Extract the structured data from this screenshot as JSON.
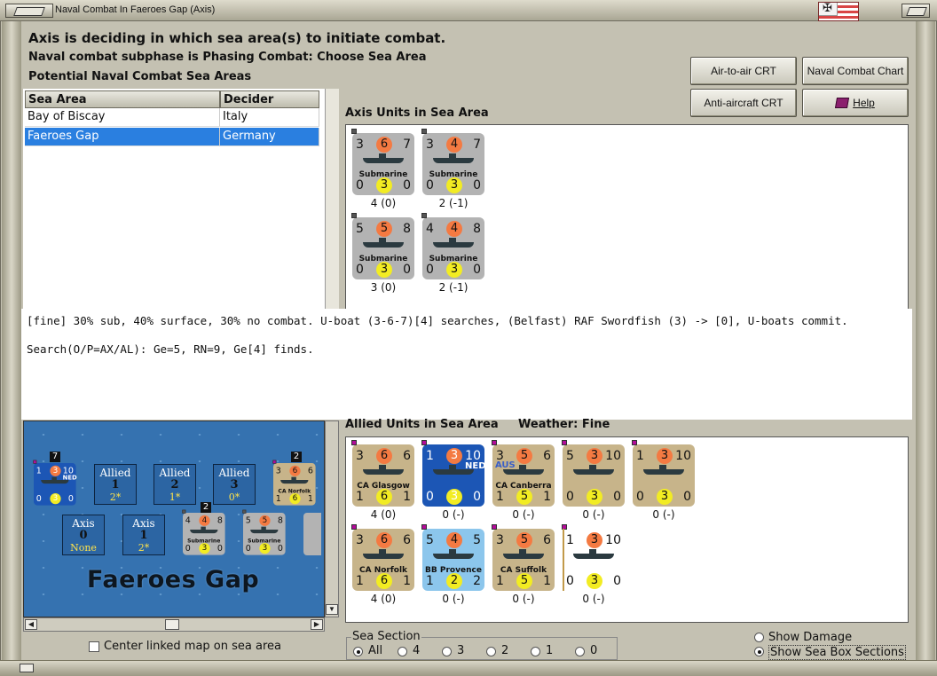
{
  "window": {
    "title": "Naval Combat In Faeroes Gap (Axis)"
  },
  "header": {
    "line1": "Axis is deciding in which sea area(s) to initiate combat.",
    "line2": "Naval combat subphase is Phasing Combat: Choose Sea Area",
    "line3": "Potential Naval Combat Sea Areas"
  },
  "buttons": {
    "air_to_air": "Air-to-air CRT",
    "naval_chart": "Naval Combat Chart",
    "anti_aircraft": "Anti-aircraft CRT",
    "help": "Help"
  },
  "sea_table": {
    "col_area": "Sea Area",
    "col_decider": "Decider",
    "rows": [
      {
        "area": "Bay of Biscay",
        "decider": "Italy",
        "selected": false
      },
      {
        "area": "Faeroes Gap",
        "decider": "Germany",
        "selected": true
      }
    ]
  },
  "axis_units": {
    "label": "Axis Units in Sea Area",
    "units": [
      {
        "tl": "3",
        "tc": "6",
        "tr": "7",
        "name": "Submarine",
        "bl": "0",
        "bc": "3",
        "br": "0",
        "tag": "4 (0)"
      },
      {
        "tl": "3",
        "tc": "4",
        "tr": "7",
        "name": "Submarine",
        "bl": "0",
        "bc": "3",
        "br": "0",
        "tag": "2 (-1)"
      },
      {
        "tl": "5",
        "tc": "5",
        "tr": "8",
        "name": "Submarine",
        "bl": "0",
        "bc": "3",
        "br": "0",
        "tag": "3 (0)"
      },
      {
        "tl": "4",
        "tc": "4",
        "tr": "8",
        "name": "Submarine",
        "bl": "0",
        "bc": "3",
        "br": "0",
        "tag": "2 (-1)"
      }
    ]
  },
  "message": {
    "line1": "[fine]  30% sub, 40% surface, 30% no combat.  U-boat (3-6-7)[4] searches, (Belfast) RAF Swordfish (3) -> [0], U-boats commit.",
    "line2": "Search(O/P=AX/AL):  Ge=5, RN=9, Ge[4] finds."
  },
  "map": {
    "title": "Faeroes Gap",
    "allied_boxes": [
      {
        "label": "Allied",
        "num": "1",
        "sub": "2*"
      },
      {
        "label": "Allied",
        "num": "2",
        "sub": "1*"
      },
      {
        "label": "Allied",
        "num": "3",
        "sub": "0*"
      }
    ],
    "axis_boxes": [
      {
        "label": "Axis",
        "num": "0",
        "sub": "None"
      },
      {
        "label": "Axis",
        "num": "1",
        "sub": "2*"
      }
    ],
    "stack_top_badge": "7",
    "stack_right_badge": "2",
    "stack_sub_badge": "2",
    "mini_ned": {
      "tl": "1",
      "tc": "3",
      "tr": "10",
      "bl": "0",
      "bc": "3",
      "br": "0",
      "flag": "NED"
    },
    "mini_norfolk": {
      "tl": "3",
      "tc": "6",
      "tr": "6",
      "name": "CA Norfolk",
      "bl": "1",
      "bc": "6",
      "br": "1"
    },
    "mini_sub1": {
      "tl": "4",
      "tc": "4",
      "tr": "8",
      "name": "Submarine",
      "bl": "0",
      "bc": "3",
      "br": "0"
    },
    "mini_sub2": {
      "tl": "5",
      "tc": "5",
      "tr": "8",
      "name": "Submarine",
      "bl": "0",
      "bc": "3",
      "br": "0"
    }
  },
  "allied_units": {
    "label": "Allied Units in Sea Area",
    "weather": "Weather:  Fine",
    "units": [
      {
        "tl": "3",
        "tc": "6",
        "tr": "6",
        "name": "CA Glasgow",
        "bl": "1",
        "bc": "6",
        "br": "1",
        "tag": "4 (0)",
        "style": "tan"
      },
      {
        "tl": "1",
        "tc": "3",
        "tr": "10",
        "name": "",
        "flag": "NED",
        "bl": "0",
        "bc": "3",
        "br": "0",
        "tag": "0 (-)",
        "style": "navy"
      },
      {
        "tl": "3",
        "tc": "5",
        "tr": "6",
        "name": "CA Canberra",
        "flag": "AUS",
        "bl": "1",
        "bc": "5",
        "br": "1",
        "tag": "0 (-)",
        "style": "tan"
      },
      {
        "tl": "5",
        "tc": "3",
        "tr": "10",
        "name": "",
        "bl": "0",
        "bc": "3",
        "br": "0",
        "tag": "0 (-)",
        "style": "tan"
      },
      {
        "tl": "1",
        "tc": "3",
        "tr": "10",
        "name": "",
        "bl": "0",
        "bc": "3",
        "br": "0",
        "tag": "0 (-)",
        "style": "tan"
      },
      {
        "tl": "3",
        "tc": "6",
        "tr": "6",
        "name": "CA Norfolk",
        "bl": "1",
        "bc": "6",
        "br": "1",
        "tag": "4 (0)",
        "style": "tan"
      },
      {
        "tl": "5",
        "tc": "4",
        "tr": "5",
        "name": "BB Provence",
        "bl": "1",
        "bc": "2",
        "br": "2",
        "tag": "0 (-)",
        "style": "lightblue"
      },
      {
        "tl": "3",
        "tc": "5",
        "tr": "6",
        "name": "CA Suffolk",
        "bl": "1",
        "bc": "5",
        "br": "1",
        "tag": "0 (-)",
        "style": "tan"
      },
      {
        "tl": "1",
        "tc": "3",
        "tr": "10",
        "name": "",
        "bl": "0",
        "bc": "3",
        "br": "0",
        "tag": "0 (-)",
        "style": "white"
      }
    ]
  },
  "controls": {
    "center_map": "Center linked map on sea area",
    "sea_section_title": "Sea Section",
    "sea_section_options": [
      "All",
      "4",
      "3",
      "2",
      "1",
      "0"
    ],
    "sea_section_selected": "All",
    "show_damage": "Show Damage",
    "show_sections": "Show Sea Box Sections"
  },
  "colors": {
    "selection": "#2a7fe0",
    "sea": "#3572b0",
    "attack": "#f47a42",
    "defense": "#f2ec23"
  }
}
